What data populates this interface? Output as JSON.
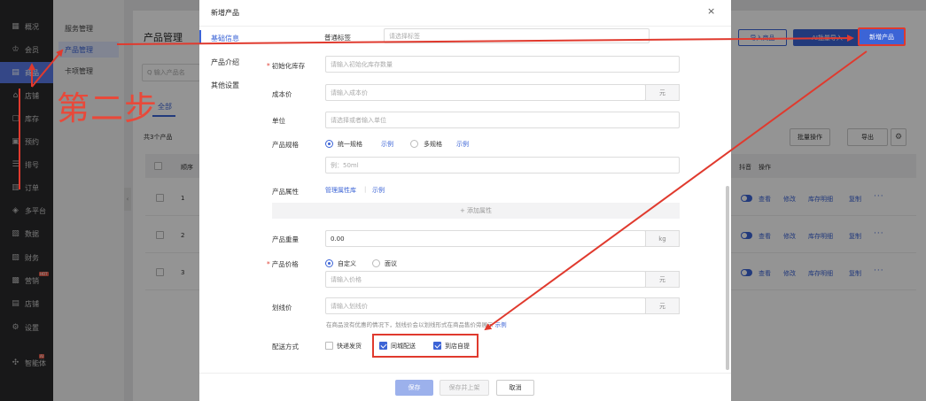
{
  "sidebar": {
    "items": [
      {
        "icon": "grid-icon",
        "glyph": "▦",
        "label": "概况"
      },
      {
        "icon": "crown-icon",
        "glyph": "♔",
        "label": "会员"
      },
      {
        "icon": "shop-icon",
        "glyph": "▤",
        "label": "商品"
      },
      {
        "icon": "house-icon",
        "glyph": "⌂",
        "label": "店铺"
      },
      {
        "icon": "box-icon",
        "glyph": "▢",
        "label": "库存"
      },
      {
        "icon": "calendar-icon",
        "glyph": "▣",
        "label": "预约"
      },
      {
        "icon": "queue-icon",
        "glyph": "☰",
        "label": "排号"
      },
      {
        "icon": "order-icon",
        "glyph": "▥",
        "label": "订单"
      },
      {
        "icon": "layers-icon",
        "glyph": "◈",
        "label": "多平台"
      },
      {
        "icon": "data-icon",
        "glyph": "▧",
        "label": "数据"
      },
      {
        "icon": "finance-icon",
        "glyph": "▨",
        "label": "财务"
      },
      {
        "icon": "marketing-icon",
        "glyph": "▩",
        "label": "营销",
        "badge": "HOT"
      },
      {
        "icon": "store-icon",
        "glyph": "▤",
        "label": "店铺"
      },
      {
        "icon": "settings-icon",
        "glyph": "⚙",
        "label": "设置"
      },
      {
        "icon": "ai-icon",
        "glyph": "✣",
        "label": "智能体",
        "badge": "AI"
      }
    ],
    "active_index": 2
  },
  "subnav": {
    "items": [
      "服务管理",
      "产品管理",
      "卡项管理"
    ],
    "active_index": 1
  },
  "main": {
    "title": "产品管理",
    "search_placeholder": "Q 输入产品名",
    "tab_all": "全部",
    "count": "共3个产品",
    "btn_import": "导入商品",
    "btn_batch": "AI批量导入",
    "btn_new": "新增产品",
    "btn_bulk": "批量操作",
    "btn_export": "导出",
    "table": {
      "col_seq": "顺序",
      "col_douyin": "抖音",
      "col_ops": "操作",
      "rows": [
        "1",
        "2",
        "3"
      ],
      "ops": [
        "查看",
        "修改",
        "库存明细",
        "复制",
        "···"
      ]
    }
  },
  "modal": {
    "title": "新增产品",
    "close": "×",
    "nav": [
      "基础信息",
      "产品介绍",
      "其他设置"
    ],
    "nav_active": 0,
    "fields": {
      "tag_label": "普通标签",
      "tag_placeholder": "请选择标签",
      "init_stock_label": "初始化库存",
      "init_stock_placeholder": "请输入初始化库存数量",
      "cost_label": "成本价",
      "cost_placeholder": "请输入成本价",
      "cost_suffix": "元",
      "unit_label": "单位",
      "unit_placeholder": "请选择或者输入单位",
      "spec_label": "产品规格",
      "spec_unified": "统一规格",
      "spec_example": "示例",
      "spec_multi": "多规格",
      "spec_example2": "示例",
      "spec_placeholder": "例：50ml",
      "attr_label": "产品属性",
      "attr_manage": "管理属性库",
      "attr_example": "示例",
      "attr_add": "+ 添加属性",
      "weight_label": "产品重量",
      "weight_value": "0.00",
      "weight_suffix": "kg",
      "price_label": "产品价格",
      "price_custom": "自定义",
      "price_negotiable": "面议",
      "price_placeholder": "请输入价格",
      "price_suffix": "元",
      "strike_label": "划线价",
      "strike_placeholder": "请输入划线价",
      "strike_suffix": "元",
      "strike_help": "在商品没有优惠的情况下，划线价会以划线形式在商品售价旁展示",
      "strike_help_link": "示例",
      "delivery_label": "配送方式",
      "delivery_express": "快递发货",
      "delivery_local": "同城配送",
      "delivery_pickup": "到店自提"
    },
    "footer": {
      "save": "保存",
      "save_publish": "保存并上架",
      "cancel": "取消"
    }
  },
  "annotation": {
    "step_text": "第二步",
    "color": "#e03a2e"
  }
}
